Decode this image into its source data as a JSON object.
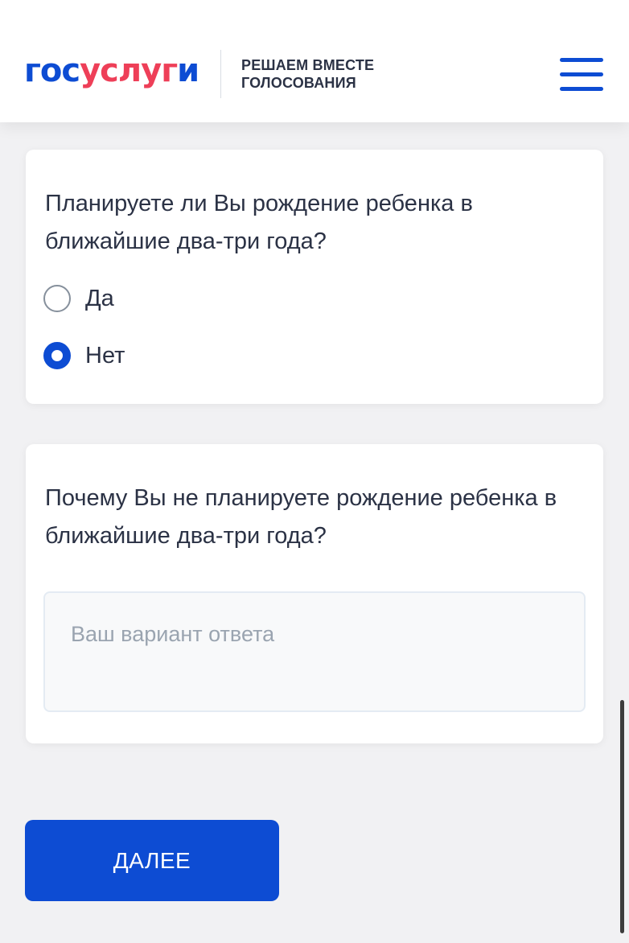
{
  "header": {
    "logo": {
      "part1": "гос",
      "part2": "услуг",
      "part3": "и"
    },
    "subtitle_line1": "РЕШАЕМ ВМЕСТЕ",
    "subtitle_line2": "ГОЛОСОВАНИЯ",
    "menu_icon": "hamburger-menu-icon"
  },
  "question1": {
    "text": "Планируете ли Вы рождение ребенка в ближайшие два-три года?",
    "options": [
      {
        "label": "Да",
        "selected": false
      },
      {
        "label": "Нет",
        "selected": true
      }
    ]
  },
  "question2": {
    "text": "Почему Вы не планируете рождение ребенка в ближайшие два-три года?",
    "answer_value": "",
    "answer_placeholder": "Ваш вариант ответа"
  },
  "next_button": {
    "label": "ДАЛЕЕ"
  },
  "colors": {
    "brand_blue": "#0d4cd3",
    "brand_red": "#ee3f58",
    "text": "#2b3245",
    "background": "#f1f1f3"
  }
}
